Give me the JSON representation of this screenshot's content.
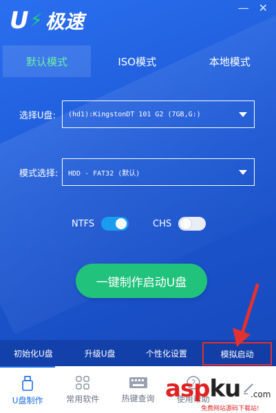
{
  "app": {
    "logo_mark": "U",
    "logo_text": "极速"
  },
  "window": {
    "minimize_icon": "minimize-icon",
    "close_icon": "close-icon",
    "minimize_glyph": "—",
    "close_glyph": "✕"
  },
  "tabs": [
    {
      "label": "默认模式",
      "active": true
    },
    {
      "label": "ISO模式",
      "active": false
    },
    {
      "label": "本地模式",
      "active": false
    }
  ],
  "usb_select": {
    "label": "选择U盘:",
    "value": "(hd1):KingstonDT 101 G2          (7GB,G:)"
  },
  "mode_select": {
    "label": "模式选择:",
    "value": "HDD - FAT32 (默认)"
  },
  "toggles": {
    "ntfs": {
      "label": "NTFS",
      "on": true
    },
    "chs": {
      "label": "CHS",
      "on": false
    }
  },
  "primary_action": {
    "label": "一键制作启动U盘"
  },
  "tools": [
    {
      "label": "初始化U盘"
    },
    {
      "label": "升级U盘"
    },
    {
      "label": "个性化设置"
    },
    {
      "label": "模拟启动"
    }
  ],
  "nav": [
    {
      "label": "U盘制作",
      "icon": "usb-icon",
      "active": true
    },
    {
      "label": "常用软件",
      "icon": "grid-icon",
      "active": false
    },
    {
      "label": "热键查询",
      "icon": "keyboard-icon",
      "active": false
    },
    {
      "label": "使用帮助",
      "icon": "help-icon",
      "active": false
    },
    {
      "label": "",
      "icon": "edit-icon",
      "active": false
    }
  ],
  "watermark": {
    "main_a": "asp",
    "main_k": "ku",
    "com": ".com",
    "sub": "免费网站源码下载站!"
  },
  "colors": {
    "accent_green": "#21c27c",
    "highlight_red": "#e33030",
    "nav_active": "#1b6de6"
  }
}
